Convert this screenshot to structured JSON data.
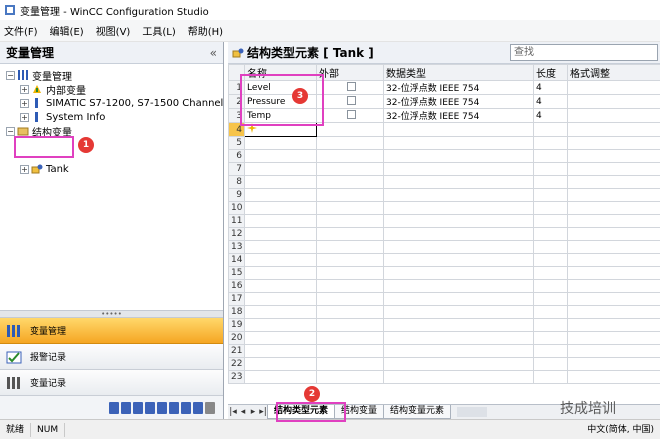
{
  "window": {
    "title": "变量管理 - WinCC Configuration Studio"
  },
  "menu": [
    "文件(F)",
    "编辑(E)",
    "视图(V)",
    "工具(L)",
    "帮助(H)"
  ],
  "left_panel": {
    "title": "变量管理",
    "collapse_glyph": "«",
    "tree": {
      "root": "变量管理",
      "children": [
        "内部变量",
        "SIMATIC S7-1200, S7-1500 Channel",
        "System Info"
      ],
      "struct_root": "结构变量",
      "struct_children": [
        "Tank"
      ]
    },
    "nav_buttons": [
      "变量管理",
      "报警记录",
      "变量记录"
    ]
  },
  "editor": {
    "title": "结构类型元素 [ Tank ]",
    "search_placeholder": "查找",
    "columns": [
      "名称",
      "外部",
      "数据类型",
      "长度",
      "格式调整"
    ],
    "rows": [
      {
        "num": "1",
        "name": "Level",
        "type": "32-位浮点数 IEEE 754",
        "length": "4"
      },
      {
        "num": "2",
        "name": "Pressure",
        "type": "32-位浮点数 IEEE 754",
        "length": "4"
      },
      {
        "num": "3",
        "name": "Temp",
        "type": "32-位浮点数 IEEE 754",
        "length": "4"
      }
    ],
    "current_row_num": "4",
    "empty_rows": [
      "5",
      "6",
      "7",
      "8",
      "9",
      "10",
      "11",
      "12",
      "13",
      "14",
      "15",
      "16",
      "17",
      "18",
      "19",
      "20",
      "21",
      "22",
      "23"
    ],
    "tabs": [
      "结构类型元素",
      "结构变量",
      "结构变量元素"
    ]
  },
  "annotations": [
    "1",
    "2",
    "3"
  ],
  "watermark": "技成培训",
  "status": {
    "left": "就绪",
    "num": "NUM",
    "locale": "中文(简体, 中国)"
  },
  "colors": {
    "highlight": "#e040c0",
    "badge": "#e53935",
    "active_nav": "#f5a623"
  }
}
